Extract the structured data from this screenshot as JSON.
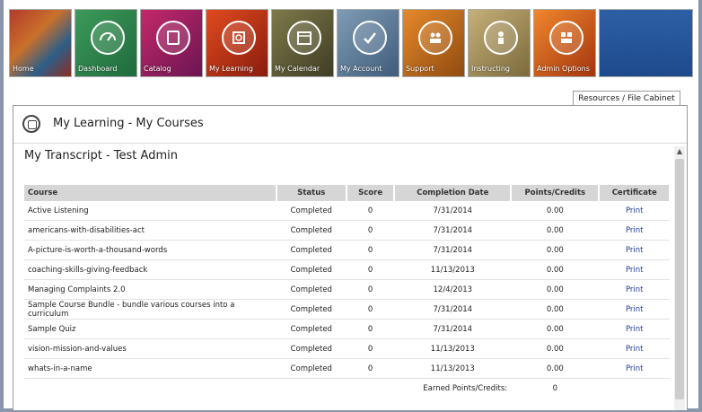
{
  "nav": {
    "tiles": [
      {
        "label": "Home",
        "icon": "home-icon"
      },
      {
        "label": "Dashboard",
        "icon": "speedometer-icon"
      },
      {
        "label": "Catalog",
        "icon": "book-icon"
      },
      {
        "label": "My Learning",
        "icon": "learning-icon"
      },
      {
        "label": "My Calendar",
        "icon": "calendar-icon"
      },
      {
        "label": "My Account",
        "icon": "checkmark-icon"
      },
      {
        "label": "Support",
        "icon": "people-icon"
      },
      {
        "label": "Instructing",
        "icon": "instructor-icon"
      },
      {
        "label": "Admin Options",
        "icon": "admin-icon"
      }
    ]
  },
  "resources_tab": "Resources / File Cabinet",
  "panel": {
    "title": "My Learning - My Courses",
    "transcript_title": "My Transcript - Test Admin"
  },
  "table": {
    "headers": [
      "Course",
      "Status",
      "Score",
      "Completion Date",
      "Points/Credits",
      "Certificate"
    ],
    "rows": [
      {
        "course": "Active Listening",
        "status": "Completed",
        "score": "0",
        "date": "7/31/2014",
        "points": "0.00",
        "cert": "Print"
      },
      {
        "course": "americans-with-disabilities-act",
        "status": "Completed",
        "score": "0",
        "date": "7/31/2014",
        "points": "0.00",
        "cert": "Print"
      },
      {
        "course": "A-picture-is-worth-a-thousand-words",
        "status": "Completed",
        "score": "0",
        "date": "7/31/2014",
        "points": "0.00",
        "cert": "Print"
      },
      {
        "course": "coaching-skills-giving-feedback",
        "status": "Completed",
        "score": "0",
        "date": "11/13/2013",
        "points": "0.00",
        "cert": "Print"
      },
      {
        "course": "Managing Complaints 2.0",
        "status": "Completed",
        "score": "0",
        "date": "12/4/2013",
        "points": "0.00",
        "cert": "Print"
      },
      {
        "course": "Sample Course Bundle - bundle various courses into a curriculum",
        "status": "Completed",
        "score": "0",
        "date": "7/31/2014",
        "points": "0.00",
        "cert": "Print"
      },
      {
        "course": "Sample Quiz",
        "status": "Completed",
        "score": "0",
        "date": "7/31/2014",
        "points": "0.00",
        "cert": "Print"
      },
      {
        "course": "vision-mission-and-values",
        "status": "Completed",
        "score": "0",
        "date": "11/13/2013",
        "points": "0.00",
        "cert": "Print"
      },
      {
        "course": "whats-in-a-name",
        "status": "Completed",
        "score": "0",
        "date": "11/13/2013",
        "points": "0.00",
        "cert": "Print"
      }
    ],
    "footer_label": "Earned Points/Credits:",
    "footer_total": "0"
  }
}
